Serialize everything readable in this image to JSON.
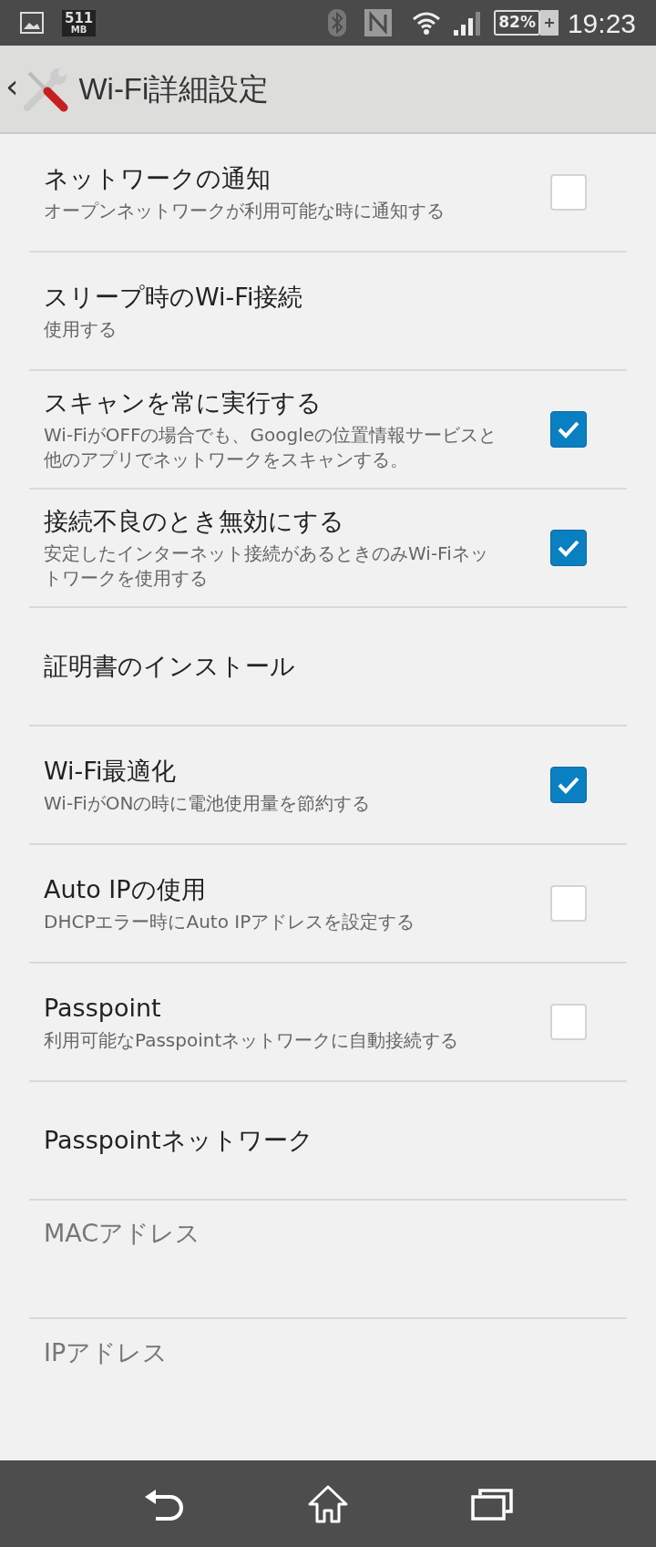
{
  "status_bar": {
    "memory_value": "511",
    "memory_unit": "MB",
    "battery": "82%",
    "charging": true,
    "time": "19:23"
  },
  "header": {
    "back": "‹",
    "title": "Wi-Fi詳細設定"
  },
  "settings": [
    {
      "kind": "checkbox",
      "title": "ネットワークの通知",
      "summary": "オープンネットワークが利用可能な時に通知する",
      "checked": false,
      "disabled": false
    },
    {
      "kind": "plain",
      "title": "スリープ時のWi-Fi接続",
      "summary": "使用する",
      "disabled": false
    },
    {
      "kind": "checkbox",
      "title": "スキャンを常に実行する",
      "summary": "Wi-FiがOFFの場合でも、Googleの位置情報サービスと他のアプリでネットワークをスキャンする。",
      "checked": true,
      "disabled": false
    },
    {
      "kind": "checkbox",
      "title": "接続不良のとき無効にする",
      "summary": "安定したインターネット接続があるときのみWi-Fiネットワークを使用する",
      "checked": true,
      "disabled": false
    },
    {
      "kind": "plain",
      "title": "証明書のインストール",
      "disabled": false
    },
    {
      "kind": "checkbox",
      "title": "Wi-Fi最適化",
      "summary": "Wi-FiがONの時に電池使用量を節約する",
      "checked": true,
      "disabled": false
    },
    {
      "kind": "checkbox",
      "title": "Auto IPの使用",
      "summary": "DHCPエラー時にAuto IPアドレスを設定する",
      "checked": false,
      "disabled": false
    },
    {
      "kind": "checkbox",
      "title": "Passpoint",
      "summary": "利用可能なPasspointネットワークに自動接続する",
      "checked": false,
      "disabled": false
    },
    {
      "kind": "plain",
      "title": "Passpointネットワーク",
      "disabled": false
    },
    {
      "kind": "info",
      "title": "MACアドレス",
      "disabled": true
    },
    {
      "kind": "info",
      "title": "IPアドレス",
      "disabled": true
    }
  ]
}
